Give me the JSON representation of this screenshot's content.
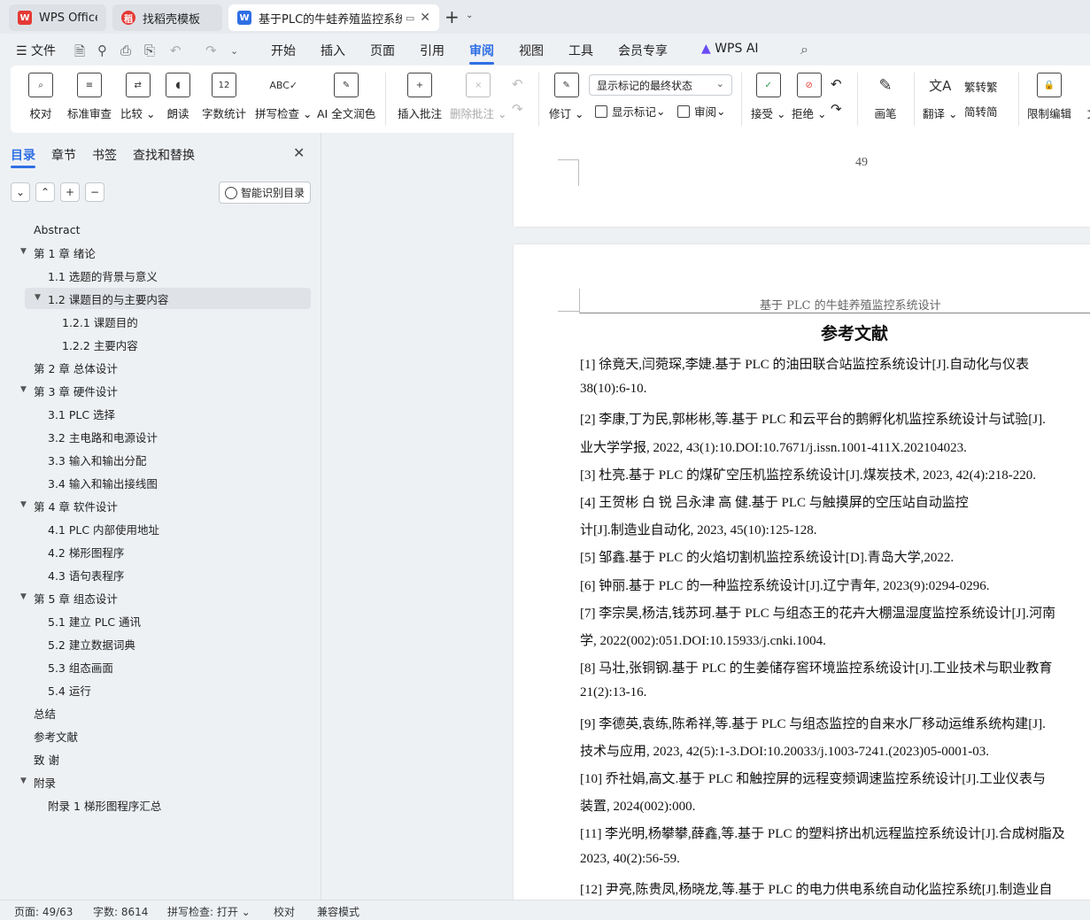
{
  "tabs": [
    {
      "label": "WPS Office"
    },
    {
      "label": "找稻壳模板"
    },
    {
      "label": "基于PLC的牛蛙养殖监控系统设"
    }
  ],
  "menu": {
    "file": "文件",
    "items": [
      "开始",
      "插入",
      "页面",
      "引用",
      "审阅",
      "视图",
      "工具",
      "会员专享"
    ],
    "ai": "WPS AI",
    "active": "审阅"
  },
  "ribbon": {
    "proofread": "校对",
    "standard_review": "标准审查",
    "compare": "比较",
    "read_aloud": "朗读",
    "word_count": "字数统计",
    "spell_check": "拼写检查",
    "ai_polish": "AI 全文润色",
    "insert_comment": "插入批注",
    "delete_comment": "删除批注",
    "revise": "修订",
    "display_select": "显示标记的最终状态",
    "show_markup": "显示标记",
    "review": "审阅",
    "accept": "接受",
    "reject": "拒绝",
    "pen": "画笔",
    "translate": "翻译",
    "to_traditional": "转繁",
    "to_simplified": "转简",
    "restrict_edit": "限制编辑",
    "cut_text": "文"
  },
  "nav": {
    "tabs": [
      "目录",
      "章节",
      "书签",
      "查找和替换"
    ],
    "smart_button": "智能识别目录",
    "toc": [
      {
        "label": "Abstract",
        "level": 0,
        "arrow": ""
      },
      {
        "label": "第 1 章  绪论",
        "level": 0,
        "arrow": "▼"
      },
      {
        "label": "1.1  选题的背景与意义",
        "level": 1,
        "arrow": ""
      },
      {
        "label": "1.2  课题目的与主要内容",
        "level": 1,
        "arrow": "▼",
        "selected": true
      },
      {
        "label": "1.2.1  课题目的",
        "level": 2,
        "arrow": ""
      },
      {
        "label": "1.2.2  主要内容",
        "level": 2,
        "arrow": ""
      },
      {
        "label": "第 2 章    总体设计",
        "level": 0,
        "arrow": ""
      },
      {
        "label": "第 3 章    硬件设计",
        "level": 0,
        "arrow": "▼"
      },
      {
        "label": "3.1 PLC 选择",
        "level": 1,
        "arrow": ""
      },
      {
        "label": "3.2  主电路和电源设计",
        "level": 1,
        "arrow": ""
      },
      {
        "label": "3.3  输入和输出分配",
        "level": 1,
        "arrow": ""
      },
      {
        "label": "3.4  输入和输出接线图",
        "level": 1,
        "arrow": ""
      },
      {
        "label": "第 4 章    软件设计",
        "level": 0,
        "arrow": "▼"
      },
      {
        "label": "4.1 PLC 内部使用地址",
        "level": 1,
        "arrow": ""
      },
      {
        "label": "4.2  梯形图程序",
        "level": 1,
        "arrow": ""
      },
      {
        "label": "4.3  语句表程序",
        "level": 1,
        "arrow": ""
      },
      {
        "label": "第 5 章    组态设计",
        "level": 0,
        "arrow": "▼"
      },
      {
        "label": "5.1 建立 PLC 通讯",
        "level": 1,
        "arrow": ""
      },
      {
        "label": "5.2  建立数据词典",
        "level": 1,
        "arrow": ""
      },
      {
        "label": "5.3  组态画面",
        "level": 1,
        "arrow": ""
      },
      {
        "label": "5.4 运行",
        "level": 1,
        "arrow": ""
      },
      {
        "label": "总结",
        "level": 0,
        "arrow": ""
      },
      {
        "label": "参考文献",
        "level": 0,
        "arrow": ""
      },
      {
        "label": "致  谢",
        "level": 0,
        "arrow": ""
      },
      {
        "label": "附录",
        "level": 0,
        "arrow": "▼"
      },
      {
        "label": "附录 1  梯形图程序汇总",
        "level": 1,
        "arrow": ""
      }
    ]
  },
  "document": {
    "prev_page_number": "49",
    "header": "基于 PLC 的牛蛙养殖监控系统设计",
    "section_title": "参考文献",
    "lines": [
      "[1]  徐竟天,闫菀琛,李婕.基于 PLC 的油田联合站监控系统设计[J].自动化与仪表",
      "38(10):6-10.",
      "[2]  李康,丁为民,郭彬彬,等.基于 PLC 和云平台的鹅孵化机监控系统设计与试验[J].",
      "业大学学报, 2022, 43(1):10.DOI:10.7671/j.issn.1001-411X.202104023.",
      "[3]  杜亮.基于 PLC 的煤矿空压机监控系统设计[J].煤炭技术, 2023, 42(4):218-220.",
      "[4]  王贺彬      白      锐      吕永津      高      健.基于 PLC 与触摸屏的空压站自动监控",
      "计[J].制造业自动化, 2023, 45(10):125-128.",
      "[5]  邹鑫.基于 PLC 的火焰切割机监控系统设计[D].青岛大学,2022.",
      "[6]  钟丽.基于 PLC 的一种监控系统设计[J].辽宁青年, 2023(9):0294-0296.",
      "[7]  李宗昊,杨洁,钱苏珂.基于 PLC 与组态王的花卉大棚温湿度监控系统设计[J].河南",
      "学, 2022(002):051.DOI:10.15933/j.cnki.1004.",
      "[8]  马壮,张铜钢.基于 PLC 的生姜储存窖环境监控系统设计[J].工业技术与职业教育",
      "21(2):13-16.",
      "[9]  李德英,袁练,陈希祥,等.基于 PLC 与组态监控的自来水厂移动运维系统构建[J].",
      "技术与应用, 2023, 42(5):1-3.DOI:10.20033/j.1003-7241.(2023)05-0001-03.",
      "[10]  乔社娟,高文.基于 PLC 和触控屏的远程变频调速监控系统设计[J].工业仪表与",
      "装置, 2024(002):000.",
      "[11]  李光明,杨攀攀,薛鑫,等.基于 PLC 的塑料挤出机远程监控系统设计[J].合成树脂及",
      "2023, 40(2):56-59.",
      "[12]  尹亮,陈贵凤,杨晓龙,等.基于 PLC 的电力供电系统自动化监控系统[J].制造业自"
    ]
  },
  "status": {
    "page": "页面: 49/63",
    "words": "字数: 8614",
    "spell": "拼写检查: 打开",
    "proof": "校对",
    "compat": "兼容模式"
  },
  "colors": {
    "accent": "#2f6fe4",
    "wps_red": "#e53935"
  }
}
